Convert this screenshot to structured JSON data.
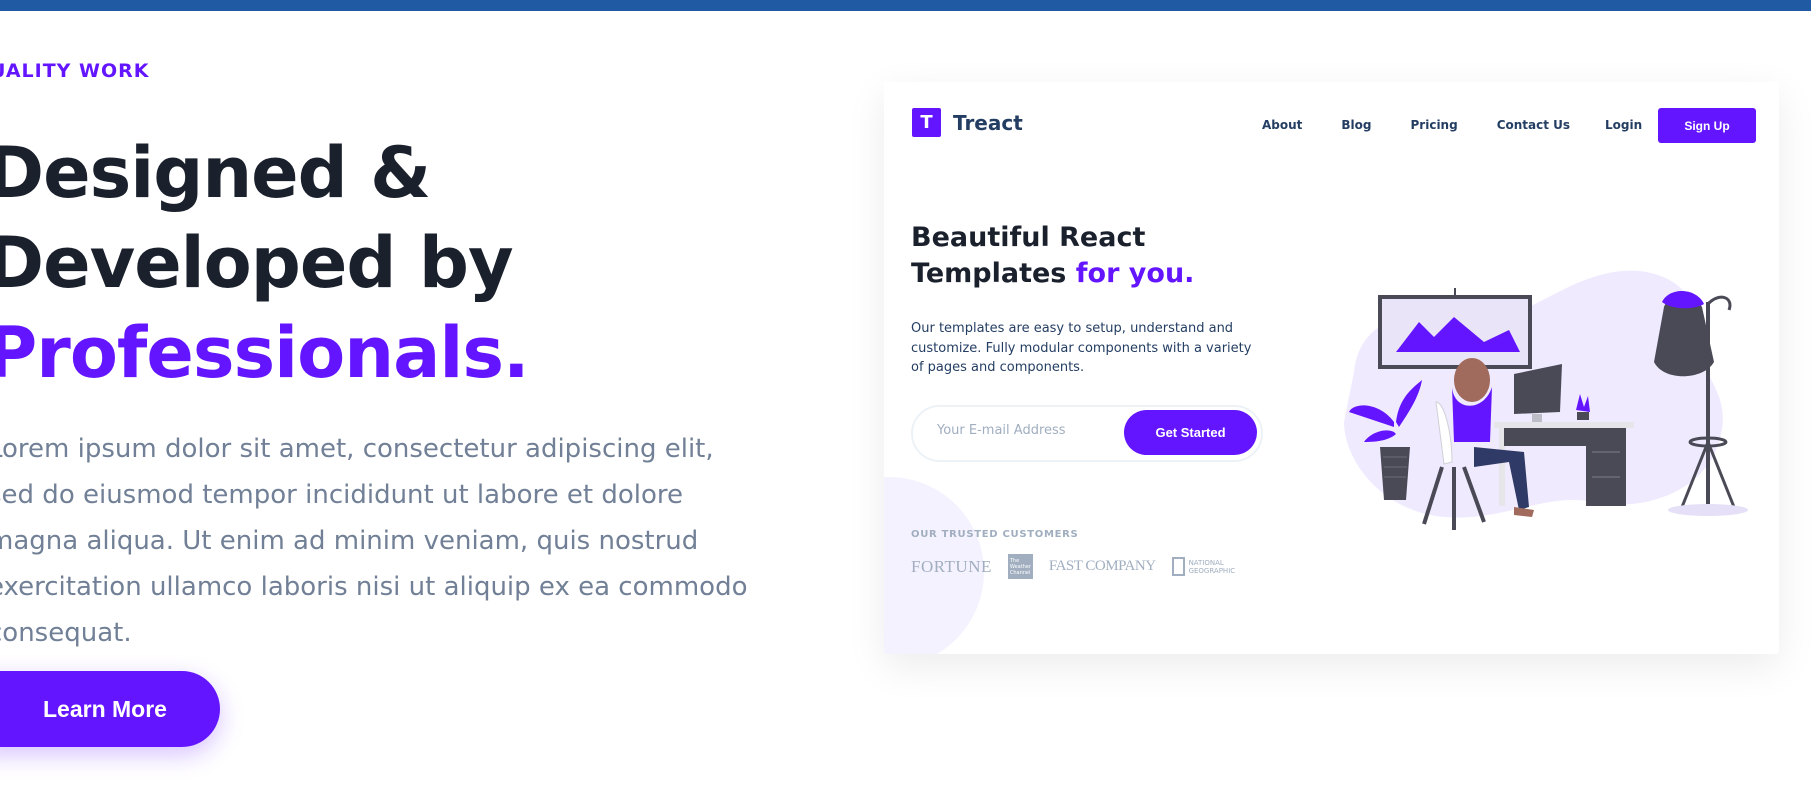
{
  "hero": {
    "eyebrow": "UALITY WORK",
    "headline_line1": "Designed &",
    "headline_line2": "Developed by",
    "headline_accent": "Professionals.",
    "description": "Lorem ipsum dolor sit amet, consectetur adipiscing elit, sed do eiusmod tempor incididunt ut labore et dolore magna aliqua. Ut enim ad minim veniam, quis nostrud exercitation ullamco laboris nisi ut aliquip ex ea commodo consequat.",
    "cta_label": "Learn More"
  },
  "preview": {
    "logo_letter": "T",
    "logo_text": "Treact",
    "nav": [
      "About",
      "Blog",
      "Pricing",
      "Contact Us"
    ],
    "login_label": "Login",
    "signup_label": "Sign Up",
    "title_line1": "Beautiful React",
    "title_line2": "Templates ",
    "title_accent": "for you.",
    "description": "Our templates are easy to setup, understand and customize. Fully modular components with a variety of pages and components.",
    "email_placeholder": "Your E-mail Address",
    "get_started_label": "Get Started",
    "trusted_label": "OUR TRUSTED CUSTOMERS",
    "customer_logos": {
      "fortune": "FORTUNE",
      "weather": "The Weather Channel",
      "fastcompany": "FAST COMPANY",
      "natgeo": "NATIONAL GEOGRAPHIC"
    }
  },
  "colors": {
    "accent": "#6415ff",
    "heading": "#1a202c",
    "body_text": "#718096",
    "top_bar": "#1f5aa3"
  }
}
